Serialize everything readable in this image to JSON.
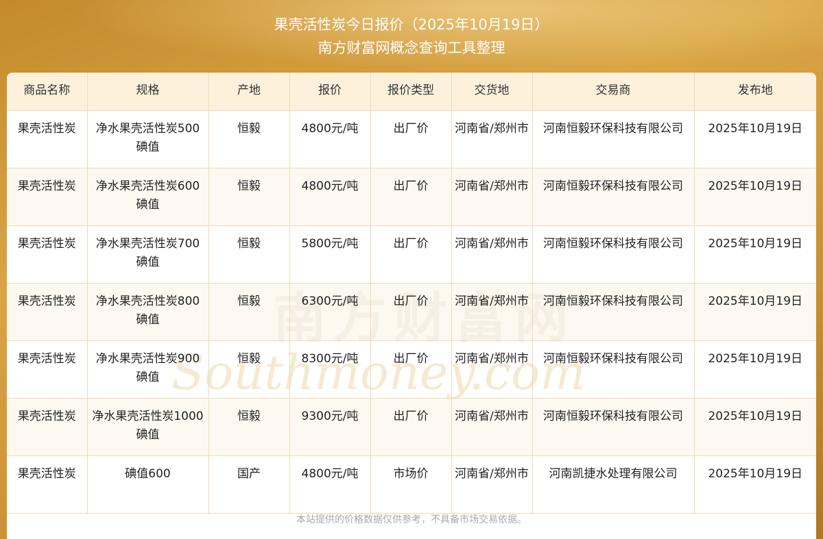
{
  "header": {
    "title": "果壳活性炭今日报价（2025年10月19日）",
    "subtitle": "南方财富网概念查询工具整理"
  },
  "table": {
    "columns": [
      "商品名称",
      "规格",
      "产地",
      "报价",
      "报价类型",
      "交货地",
      "交易商",
      "发布地"
    ],
    "rows": [
      [
        "果壳活性炭",
        "净水果壳活性炭500碘值",
        "恒毅",
        "4800元/吨",
        "出厂价",
        "河南省/郑州市",
        "河南恒毅环保科技有限公司",
        "2025年10月19日"
      ],
      [
        "果壳活性炭",
        "净水果壳活性炭600碘值",
        "恒毅",
        "4800元/吨",
        "出厂价",
        "河南省/郑州市",
        "河南恒毅环保科技有限公司",
        "2025年10月19日"
      ],
      [
        "果壳活性炭",
        "净水果壳活性炭700碘值",
        "恒毅",
        "5800元/吨",
        "出厂价",
        "河南省/郑州市",
        "河南恒毅环保科技有限公司",
        "2025年10月19日"
      ],
      [
        "果壳活性炭",
        "净水果壳活性炭800碘值",
        "恒毅",
        "6300元/吨",
        "出厂价",
        "河南省/郑州市",
        "河南恒毅环保科技有限公司",
        "2025年10月19日"
      ],
      [
        "果壳活性炭",
        "净水果壳活性炭900碘值",
        "恒毅",
        "8300元/吨",
        "出厂价",
        "河南省/郑州市",
        "河南恒毅环保科技有限公司",
        "2025年10月19日"
      ],
      [
        "果壳活性炭",
        "净水果壳活性炭1000碘值",
        "恒毅",
        "9300元/吨",
        "出厂价",
        "河南省/郑州市",
        "河南恒毅环保科技有限公司",
        "2025年10月19日"
      ],
      [
        "果壳活性炭",
        "碘值600",
        "国产",
        "4800元/吨",
        "市场价",
        "河南省/郑州市",
        "河南凯捷水处理有限公司",
        "2025年10月19日"
      ]
    ]
  },
  "watermark": {
    "cn": "南方财富网",
    "en": "Southmoney.com"
  },
  "footer": {
    "note": "本站提供的价格数据仅供参考，不具备市场交易依据。"
  }
}
